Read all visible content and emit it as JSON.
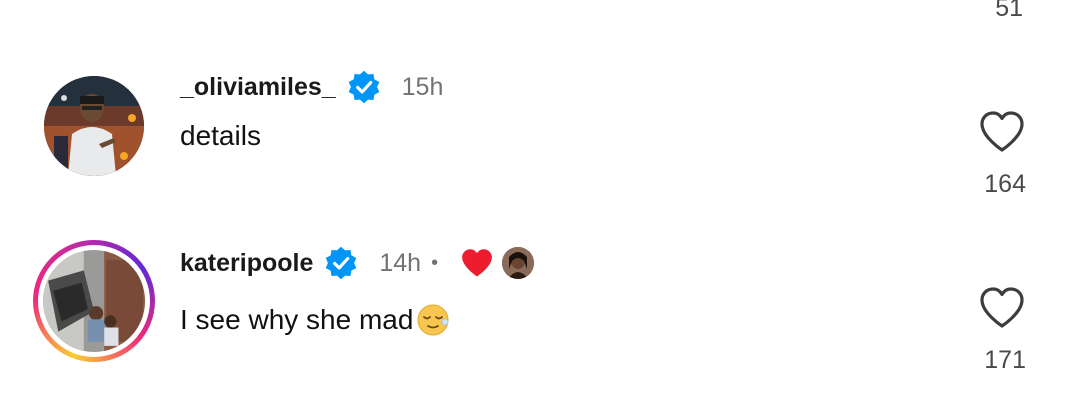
{
  "previous_comment": {
    "like_count": "51"
  },
  "comments": [
    {
      "username": "_oliviamiles_",
      "verified": true,
      "time": "15h",
      "text": "details",
      "like_count": "164"
    },
    {
      "username": "kateripoole",
      "verified": true,
      "time": "14h",
      "separator": "•",
      "liked_by_creator": true,
      "text": "I see why she mad",
      "emoji": "relieved-face",
      "like_count": "171",
      "has_story_ring": true
    }
  ],
  "colors": {
    "verified_blue": "#0095f6",
    "heart_red": "#ed1c2e",
    "muted_text": "#737373"
  }
}
